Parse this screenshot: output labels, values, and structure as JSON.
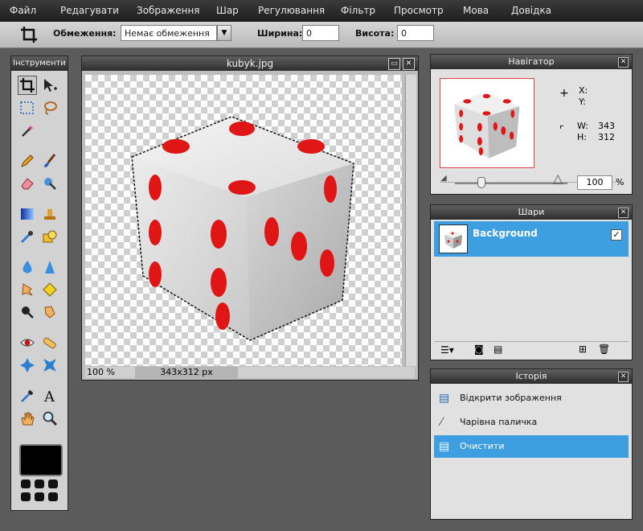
{
  "menu": [
    "Файл",
    "Редагувати",
    "Зображення",
    "Шар",
    "Регулювання",
    "Фільтр",
    "Просмотр",
    "Мова",
    "Довідка"
  ],
  "toolbar": {
    "refresh_label": "Обмеження:",
    "refresh_value": "Немає обмеження",
    "width_label": "Ширина:",
    "width_value": "0",
    "height_label": "Висота:",
    "height_value": "0"
  },
  "tools_panel": {
    "title": "Інструменти"
  },
  "document": {
    "title": "kubyk.jpg",
    "zoom": "100 %",
    "size": "343x312 px"
  },
  "navigator": {
    "title": "Навігатор",
    "x_label": "X:",
    "y_label": "Y:",
    "w_label": "W:",
    "w_value": "343",
    "h_label": "H:",
    "h_value": "312",
    "zoom_value": "100",
    "zoom_unit": "%"
  },
  "layers": {
    "title": "Шари",
    "items": [
      {
        "name": "Background",
        "visible": true
      }
    ]
  },
  "history": {
    "title": "Історія",
    "items": [
      {
        "label": "Відкрити зображення"
      },
      {
        "label": "Чарівна паличка"
      },
      {
        "label": "Очистити"
      }
    ],
    "selected_index": 2
  },
  "colors": {
    "accent": "#3d9ee0",
    "dice_dot": "#e01515"
  }
}
